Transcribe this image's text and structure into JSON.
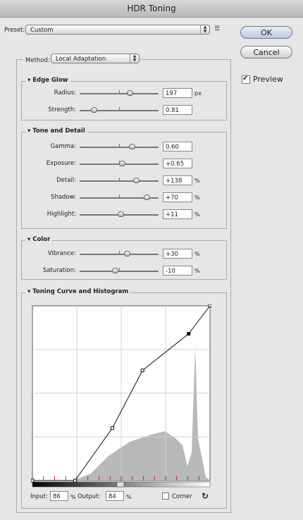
{
  "title": "HDR Toning",
  "preset": {
    "label": "Preset:",
    "value": "Custom"
  },
  "buttons": {
    "ok": "OK",
    "cancel": "Cancel"
  },
  "preview": {
    "label": "Preview",
    "checked": true
  },
  "method": {
    "label": "Method:",
    "value": "Local Adaptation"
  },
  "edge_glow": {
    "title": "Edge Glow",
    "rows": [
      {
        "label": "Radius:",
        "value": "197",
        "unit": "px",
        "position": 0.63
      },
      {
        "label": "Strength:",
        "value": "0.81",
        "unit": "",
        "position": 0.18
      }
    ]
  },
  "tone_detail": {
    "title": "Tone and Detail",
    "rows": [
      {
        "label": "Gamma:",
        "value": "0.60",
        "unit": "",
        "position": 0.66
      },
      {
        "label": "Exposure:",
        "value": "+0.65",
        "unit": "",
        "position": 0.54
      },
      {
        "label": "Detail:",
        "value": "+138",
        "unit": "%",
        "position": 0.71
      },
      {
        "label": "Shadow:",
        "value": "+70",
        "unit": "%",
        "position": 0.85
      },
      {
        "label": "Highlight:",
        "value": "+11",
        "unit": "%",
        "position": 0.52
      }
    ]
  },
  "color": {
    "title": "Color",
    "rows": [
      {
        "label": "Vibrance:",
        "value": "+30",
        "unit": "%",
        "position": 0.6
      },
      {
        "label": "Saturation:",
        "value": "-10",
        "unit": "%",
        "position": 0.45
      }
    ]
  },
  "curve": {
    "title": "Toning Curve and Histogram",
    "input_label": "Input:",
    "input_value": "86",
    "output_label": "Output:",
    "output_value": "84",
    "percent": "%",
    "corner_label": "Corner",
    "points": [
      [
        0,
        0
      ],
      [
        24,
        0
      ],
      [
        45,
        30
      ],
      [
        62,
        63
      ],
      [
        88,
        84
      ],
      [
        100,
        100
      ]
    ],
    "selected_point": 4
  }
}
